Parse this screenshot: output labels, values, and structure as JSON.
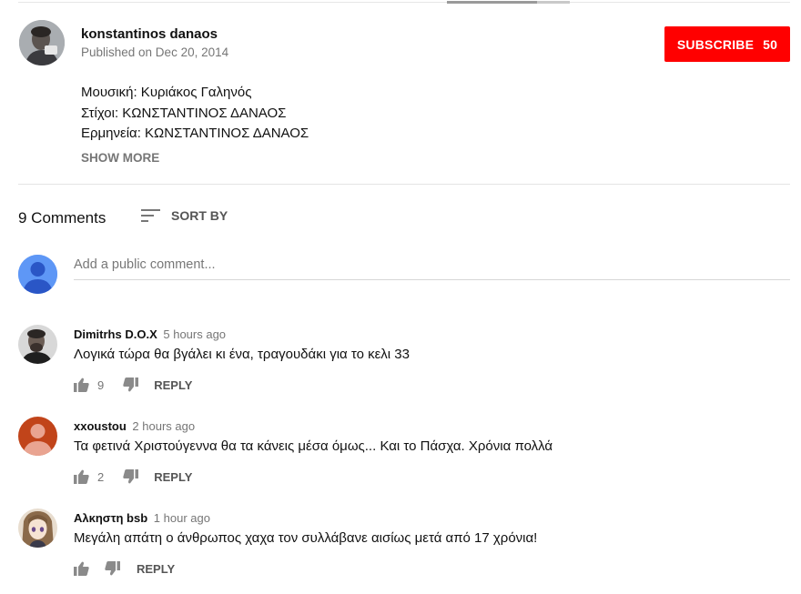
{
  "video_owner": {
    "channel_name": "konstantinos danaos",
    "published": "Published on Dec 20, 2014",
    "subscribe_label": "SUBSCRIBE",
    "subscriber_count": "50",
    "subscribe_color": "#ff0000"
  },
  "description": {
    "lines": [
      "Μουσική: Κυριάκος Γαληνός",
      "Στίχοι: ΚΩΝΣΤΑΝΤΙΝΟΣ ΔΑΝΑΟΣ",
      "Ερμηνεία: ΚΩΝΣΤΑΝΤΙΝΟΣ ΔΑΝΑΟΣ"
    ],
    "show_more_label": "SHOW MORE"
  },
  "comments_header": {
    "count_label": "9 Comments",
    "sort_label": "SORT BY",
    "sort_icon": "sort-icon"
  },
  "add_comment": {
    "placeholder": "Add a public comment...",
    "avatar_color": "#5e97f6"
  },
  "comments": [
    {
      "author": "Dimitrhs D.O.X",
      "time": "5 hours ago",
      "text": "Λογικά τώρα θα βγάλει κι ένα, τραγουδάκι για το κελι 33",
      "likes": "9",
      "reply_label": "REPLY",
      "avatar_icon": "user-photo-icon"
    },
    {
      "author": "xxoustou",
      "time": "2 hours ago",
      "text": "Τα φετινά  Χριστούγεννα θα τα κάνεις μέσα όμως... Και το Πάσχα. Χρόνια πολλά",
      "likes": "2",
      "reply_label": "REPLY",
      "avatar_color": "#c1441a"
    },
    {
      "author": "Αλκηστη bsb",
      "time": "1 hour ago",
      "text": "Μεγάλη απάτη ο άνθρωπος χαχα τον συλλάβανε αισίως μετά από 17 χρόνια!",
      "likes": "",
      "reply_label": "REPLY",
      "avatar_icon": "anime-avatar-icon"
    }
  ]
}
